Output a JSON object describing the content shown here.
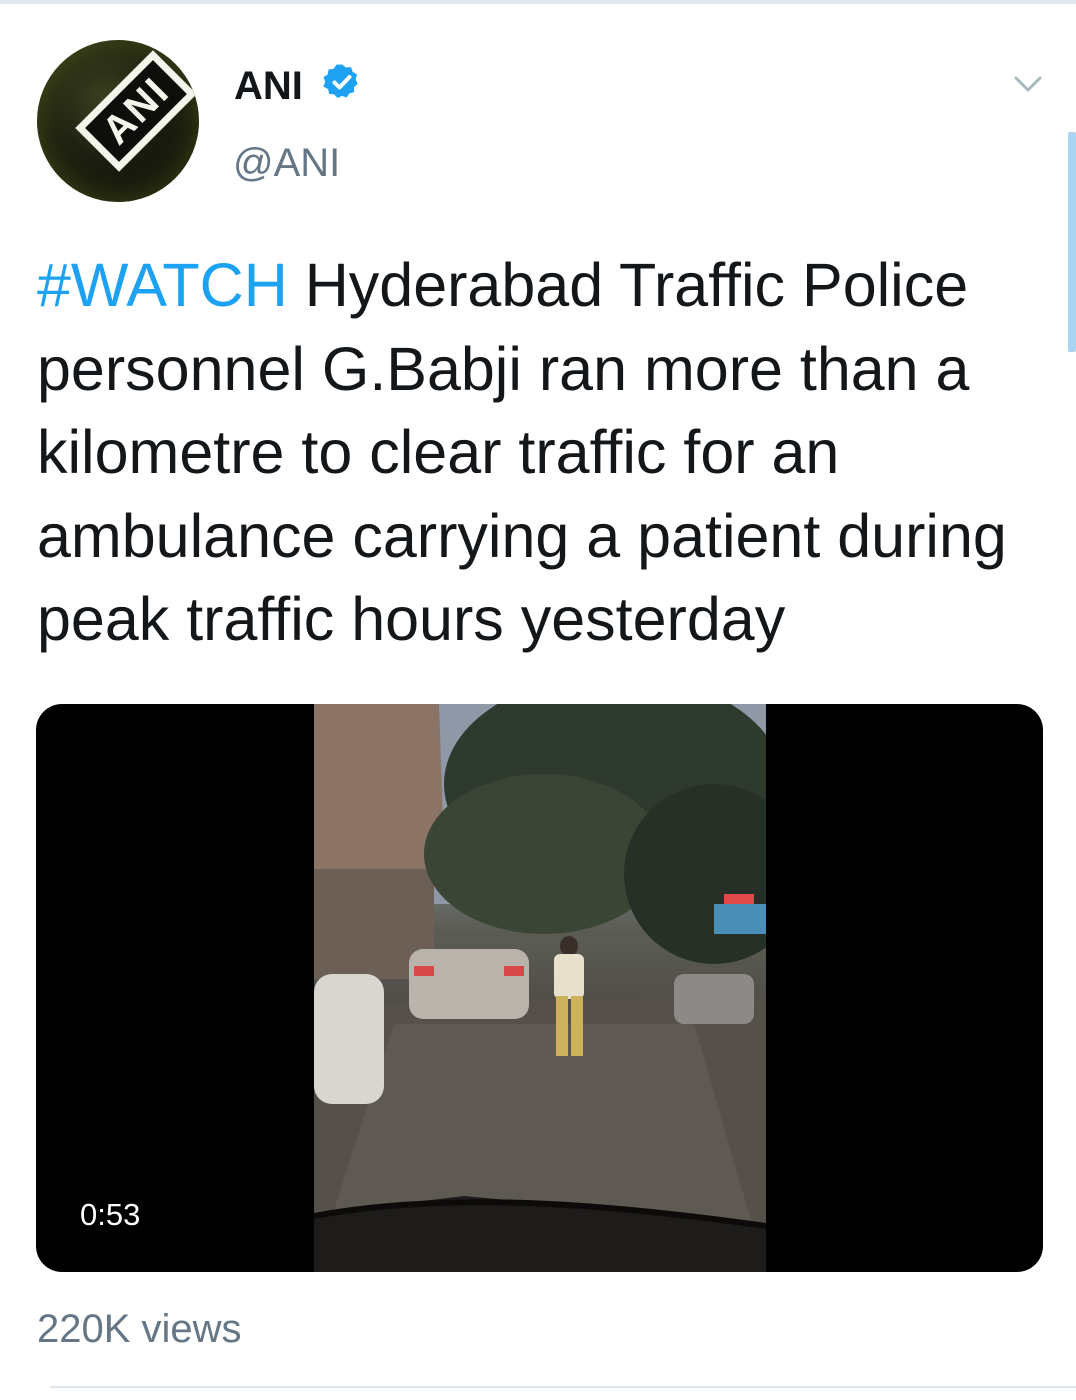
{
  "tweet": {
    "avatar_logo": "ANI",
    "account_name": "ANI",
    "handle": "@ANI",
    "hashtag": "#WATCH",
    "body": " Hyderabad Traffic Police personnel G.Babji ran more than a kilometre to clear traffic for an ambulance carrying a patient during peak traffic hours yesterday",
    "video": {
      "duration": "0:53"
    },
    "views": "220K views"
  },
  "icons": {
    "verified": "verified-badge-icon",
    "menu": "chevron-down-icon"
  },
  "colors": {
    "link": "#1da1f2",
    "muted": "#657786",
    "text": "#14171a",
    "verified": "#1da1f2"
  }
}
